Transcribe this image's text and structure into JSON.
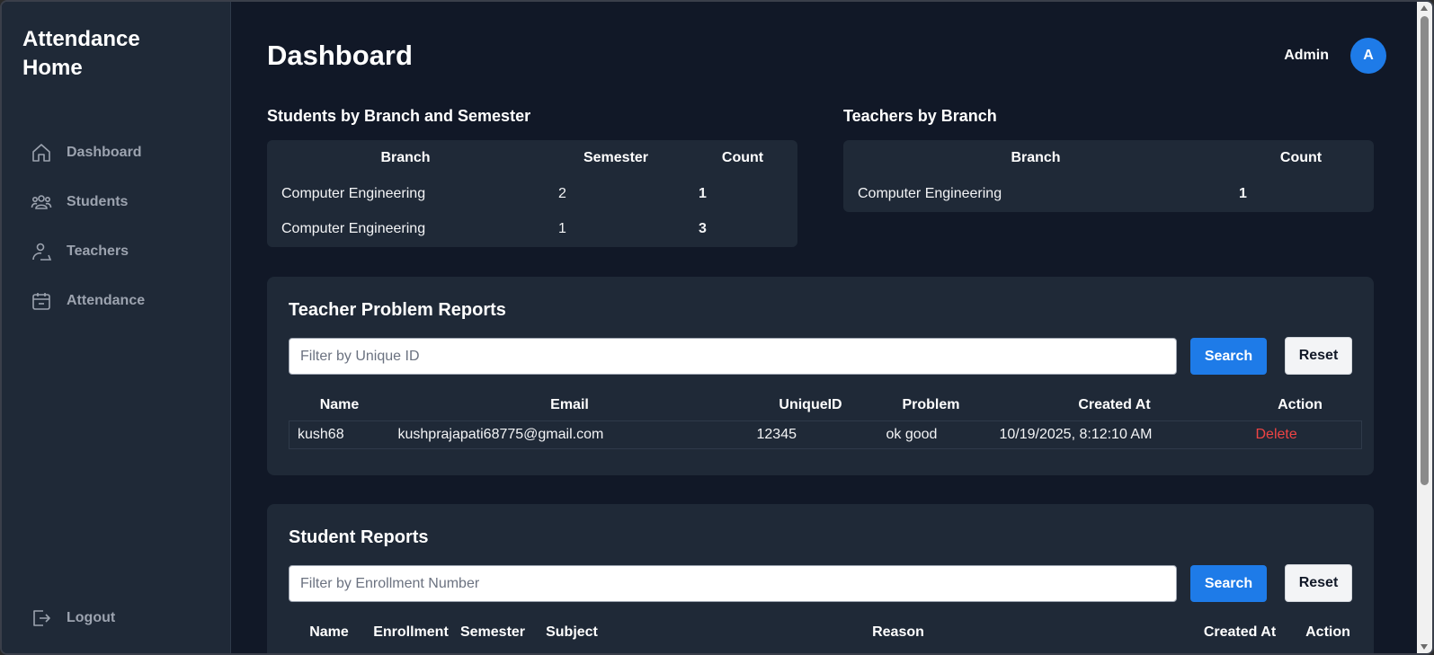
{
  "sidebar": {
    "brand": "Attendance Home",
    "items": [
      {
        "label": "Dashboard",
        "icon": "home-icon"
      },
      {
        "label": "Students",
        "icon": "users-icon"
      },
      {
        "label": "Teachers",
        "icon": "teacher-icon"
      },
      {
        "label": "Attendance",
        "icon": "calendar-icon"
      }
    ],
    "logout": {
      "label": "Logout",
      "icon": "logout-icon"
    }
  },
  "header": {
    "title": "Dashboard",
    "user_name": "Admin",
    "avatar_letter": "A"
  },
  "students_by_branch": {
    "title": "Students by Branch and Semester",
    "columns": [
      "Branch",
      "Semester",
      "Count"
    ],
    "rows": [
      [
        "Computer Engineering",
        "2",
        "1"
      ],
      [
        "Computer Engineering",
        "1",
        "3"
      ]
    ]
  },
  "teachers_by_branch": {
    "title": "Teachers by Branch",
    "columns": [
      "Branch",
      "Count"
    ],
    "rows": [
      [
        "Computer Engineering",
        "1"
      ]
    ]
  },
  "teacher_reports": {
    "title": "Teacher Problem Reports",
    "filter_placeholder": "Filter by Unique ID",
    "search_label": "Search",
    "reset_label": "Reset",
    "columns": [
      "Name",
      "Email",
      "UniqueID",
      "Problem",
      "Created At",
      "Action"
    ],
    "rows": [
      {
        "name": "kush68",
        "email": "kushprajapati68775@gmail.com",
        "unique_id": "12345",
        "problem": "ok good",
        "created_at": "10/19/2025, 8:12:10 AM",
        "action": "Delete"
      }
    ]
  },
  "student_reports": {
    "title": "Student Reports",
    "filter_placeholder": "Filter by Enrollment Number",
    "search_label": "Search",
    "reset_label": "Reset",
    "columns": [
      "Name",
      "Enrollment",
      "Semester",
      "Subject",
      "Reason",
      "Created At",
      "Action"
    ]
  },
  "colors": {
    "background": "#111827",
    "panel": "#1f2937",
    "accent": "#1e7be8",
    "danger": "#ef4444"
  }
}
